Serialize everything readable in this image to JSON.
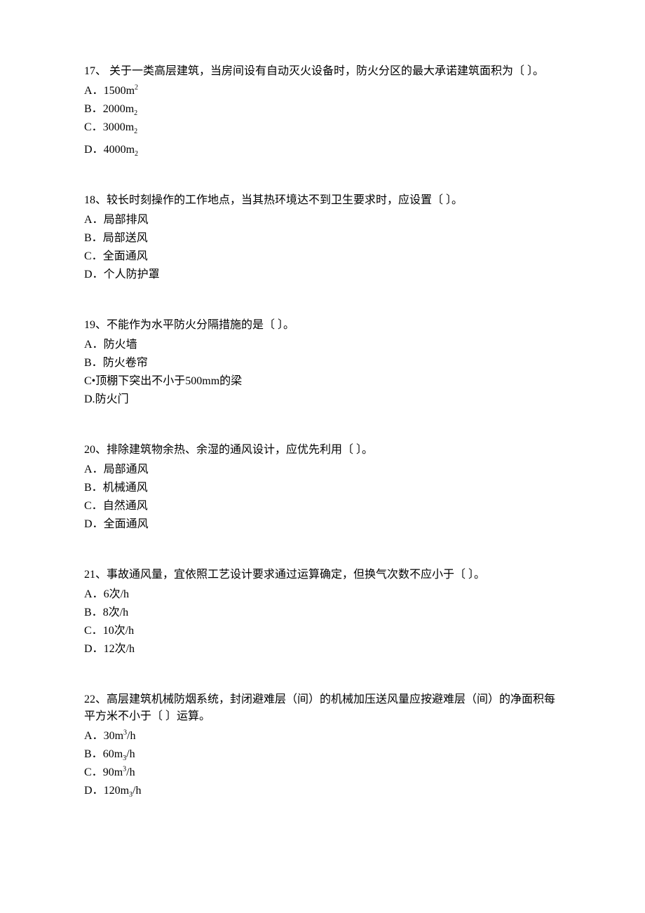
{
  "questions": [
    {
      "number": "17、",
      "text": " 关于一类高层建筑，当房间设有自动灭火设备时，防火分区的最大承诺建筑面积为〔 〕。",
      "options": [
        {
          "label": "A．",
          "value": "1500m",
          "sup": "2"
        },
        {
          "label": "B．",
          "value": "2000m",
          "sub": "2"
        },
        {
          "label": "C．",
          "value": "3000m",
          "sub": "2"
        },
        {
          "label": "D．",
          "value": "4000m",
          "sub": "2"
        }
      ]
    },
    {
      "number": "18、",
      "text": "较长时刻操作的工作地点，当其热环境达不到卫生要求时，应设置〔 〕。",
      "options": [
        {
          "label": "A．",
          "value": "局部排风"
        },
        {
          "label": "B．",
          "value": "局部送风"
        },
        {
          "label": "C．",
          "value": "全面通风"
        },
        {
          "label": "D．",
          "value": "个人防护罩"
        }
      ]
    },
    {
      "number": "19、",
      "text": "不能作为水平防火分隔措施的是〔 〕。",
      "options": [
        {
          "label": "A．",
          "value": "防火墙"
        },
        {
          "label": "B．",
          "value": "防火卷帘"
        },
        {
          "label": "C•",
          "value": "顶棚下突出不小于500mm的梁"
        },
        {
          "label": "D.",
          "value": "防火门"
        }
      ]
    },
    {
      "number": "20、",
      "text": "排除建筑物余热、余湿的通风设计，应优先利用〔 〕。",
      "options": [
        {
          "label": "A．",
          "value": "局部通风"
        },
        {
          "label": "B．",
          "value": "机械通风"
        },
        {
          "label": "C．",
          "value": "自然通风"
        },
        {
          "label": "D．",
          "value": "全面通风"
        }
      ]
    },
    {
      "number": "21、",
      "text": "事故通风量，宜依照工艺设计要求通过运算确定，但换气次数不应小于〔 〕。",
      "options": [
        {
          "label": "A．",
          "value": "6次/h"
        },
        {
          "label": "B．",
          "value": "8次/h"
        },
        {
          "label": "C．",
          "value": "10次/h"
        },
        {
          "label": "D．",
          "value": "12次/h"
        }
      ]
    },
    {
      "number": "22、",
      "text": "高层建筑机械防烟系统，封闭避难层（间）的机械加压送风量应按避难层（间）的净面积每 平方米不小于〔 〕运算。",
      "options": [
        {
          "label": "A．",
          "value": "30m",
          "sup": "3",
          "suffix": "/h"
        },
        {
          "label": "B．",
          "value": "60m",
          "sub": "3",
          "suffix": "/h"
        },
        {
          "label": "C．",
          "value": "90m",
          "sup": "3",
          "suffix": "/h"
        },
        {
          "label": "D．",
          "value": "120m",
          "sub": "3",
          "suffix": "/h"
        }
      ]
    }
  ]
}
